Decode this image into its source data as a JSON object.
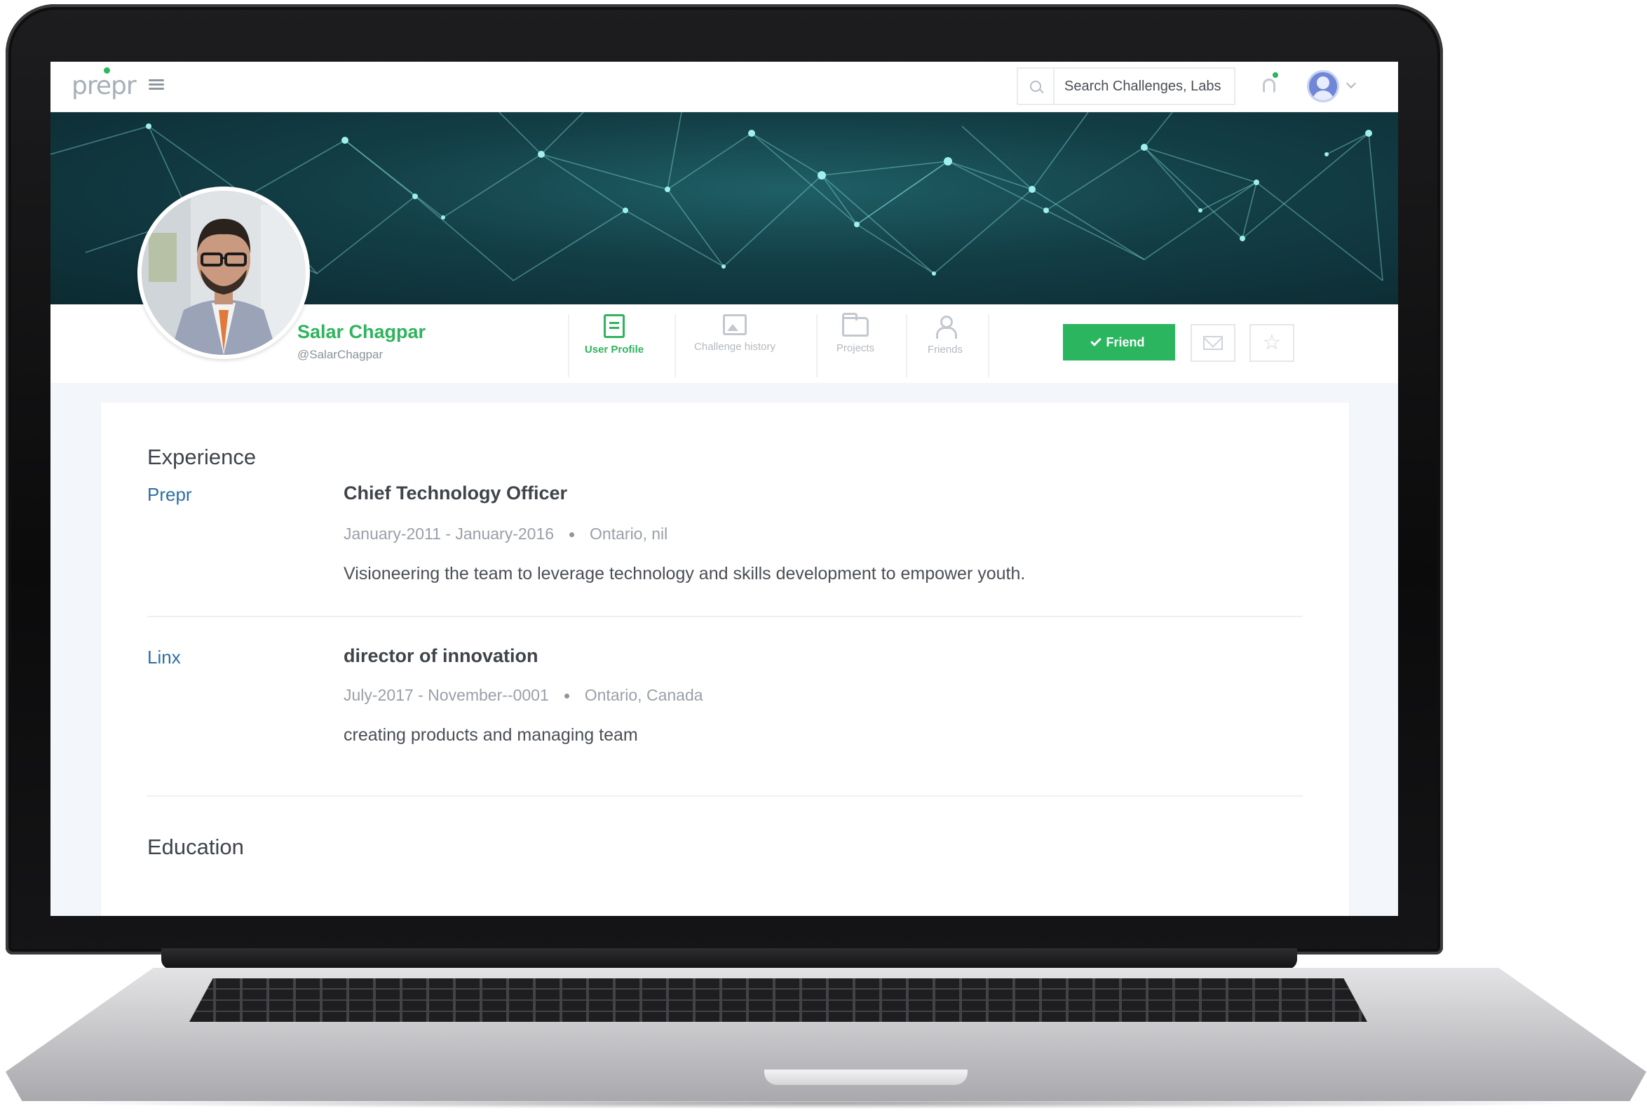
{
  "app": {
    "logo_text": "prepr",
    "brand_color": "#2bb55f",
    "link_color": "#2c6ea6"
  },
  "topnav": {
    "search_placeholder": "Search Challenges, Labs",
    "notification_icon": "bell-icon",
    "menu_icon": "hamburger-icon"
  },
  "profile": {
    "name": "Salar Chagpar",
    "handle": "@SalarChagpar",
    "tabs": [
      {
        "label": "User Profile",
        "icon": "profile-doc-icon",
        "active": true
      },
      {
        "label": "Challenge history",
        "icon": "challenge-history-icon",
        "active": false
      },
      {
        "label": "Projects",
        "icon": "folder-icon",
        "active": false
      },
      {
        "label": "Friends",
        "icon": "friends-icon",
        "active": false
      }
    ],
    "friend_button": "Friend"
  },
  "experience": {
    "title": "Experience",
    "items": [
      {
        "company": "Prepr",
        "role": "Chief Technology Officer",
        "dates": "January-2011 - January-2016",
        "location": "Ontario, nil",
        "description": "Visioneering the team to leverage technology and skills development to empower youth."
      },
      {
        "company": "Linx",
        "role": "director of innovation",
        "dates": "July-2017 - November--0001",
        "location": "Ontario, Canada",
        "description": "creating products and managing team"
      }
    ]
  },
  "education": {
    "title": "Education"
  }
}
